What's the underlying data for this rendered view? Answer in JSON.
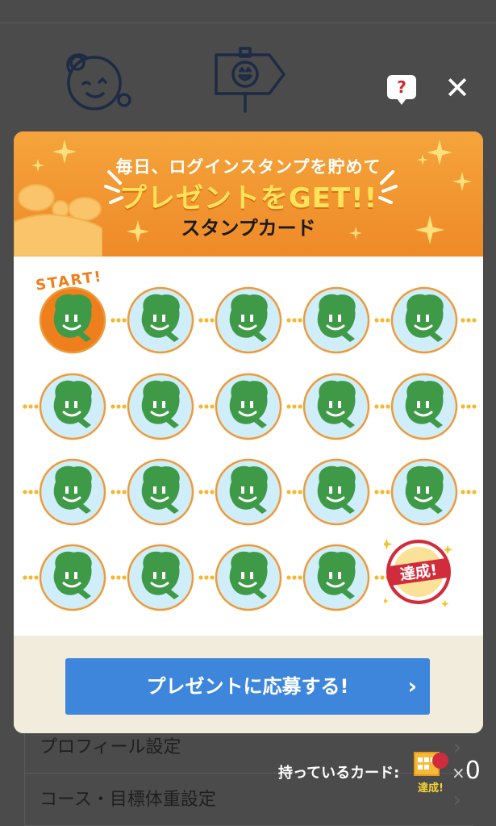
{
  "background": {
    "menu_items": [
      {
        "label": "プロフィール設定"
      },
      {
        "label": "コース・目標体重設定"
      }
    ]
  },
  "help_button": {
    "label": "?"
  },
  "close_button": {
    "label": "✕"
  },
  "modal": {
    "header": {
      "line1": "毎日、ログインスタンプを貯めて",
      "line2": "プレゼントをGET!!",
      "line3": "スタンプカード"
    },
    "start_label": "START!",
    "goal_label": "達成!",
    "stamp_count": 20,
    "stamps_collected": 1,
    "apply_button": {
      "label": "プレゼントに応募する!",
      "arrow": "›"
    }
  },
  "owned_cards": {
    "label": "持っているカード:",
    "card_badge": "達成!",
    "times": "×",
    "count": "0"
  },
  "colors": {
    "header_orange": "#f09530",
    "collected_stamp": "#ee7f1c",
    "uncollected_fill": "#cfeefa",
    "stamp_face": "#3f9a48",
    "button_blue": "#3d86dc",
    "goal_red": "#d12c3b"
  }
}
